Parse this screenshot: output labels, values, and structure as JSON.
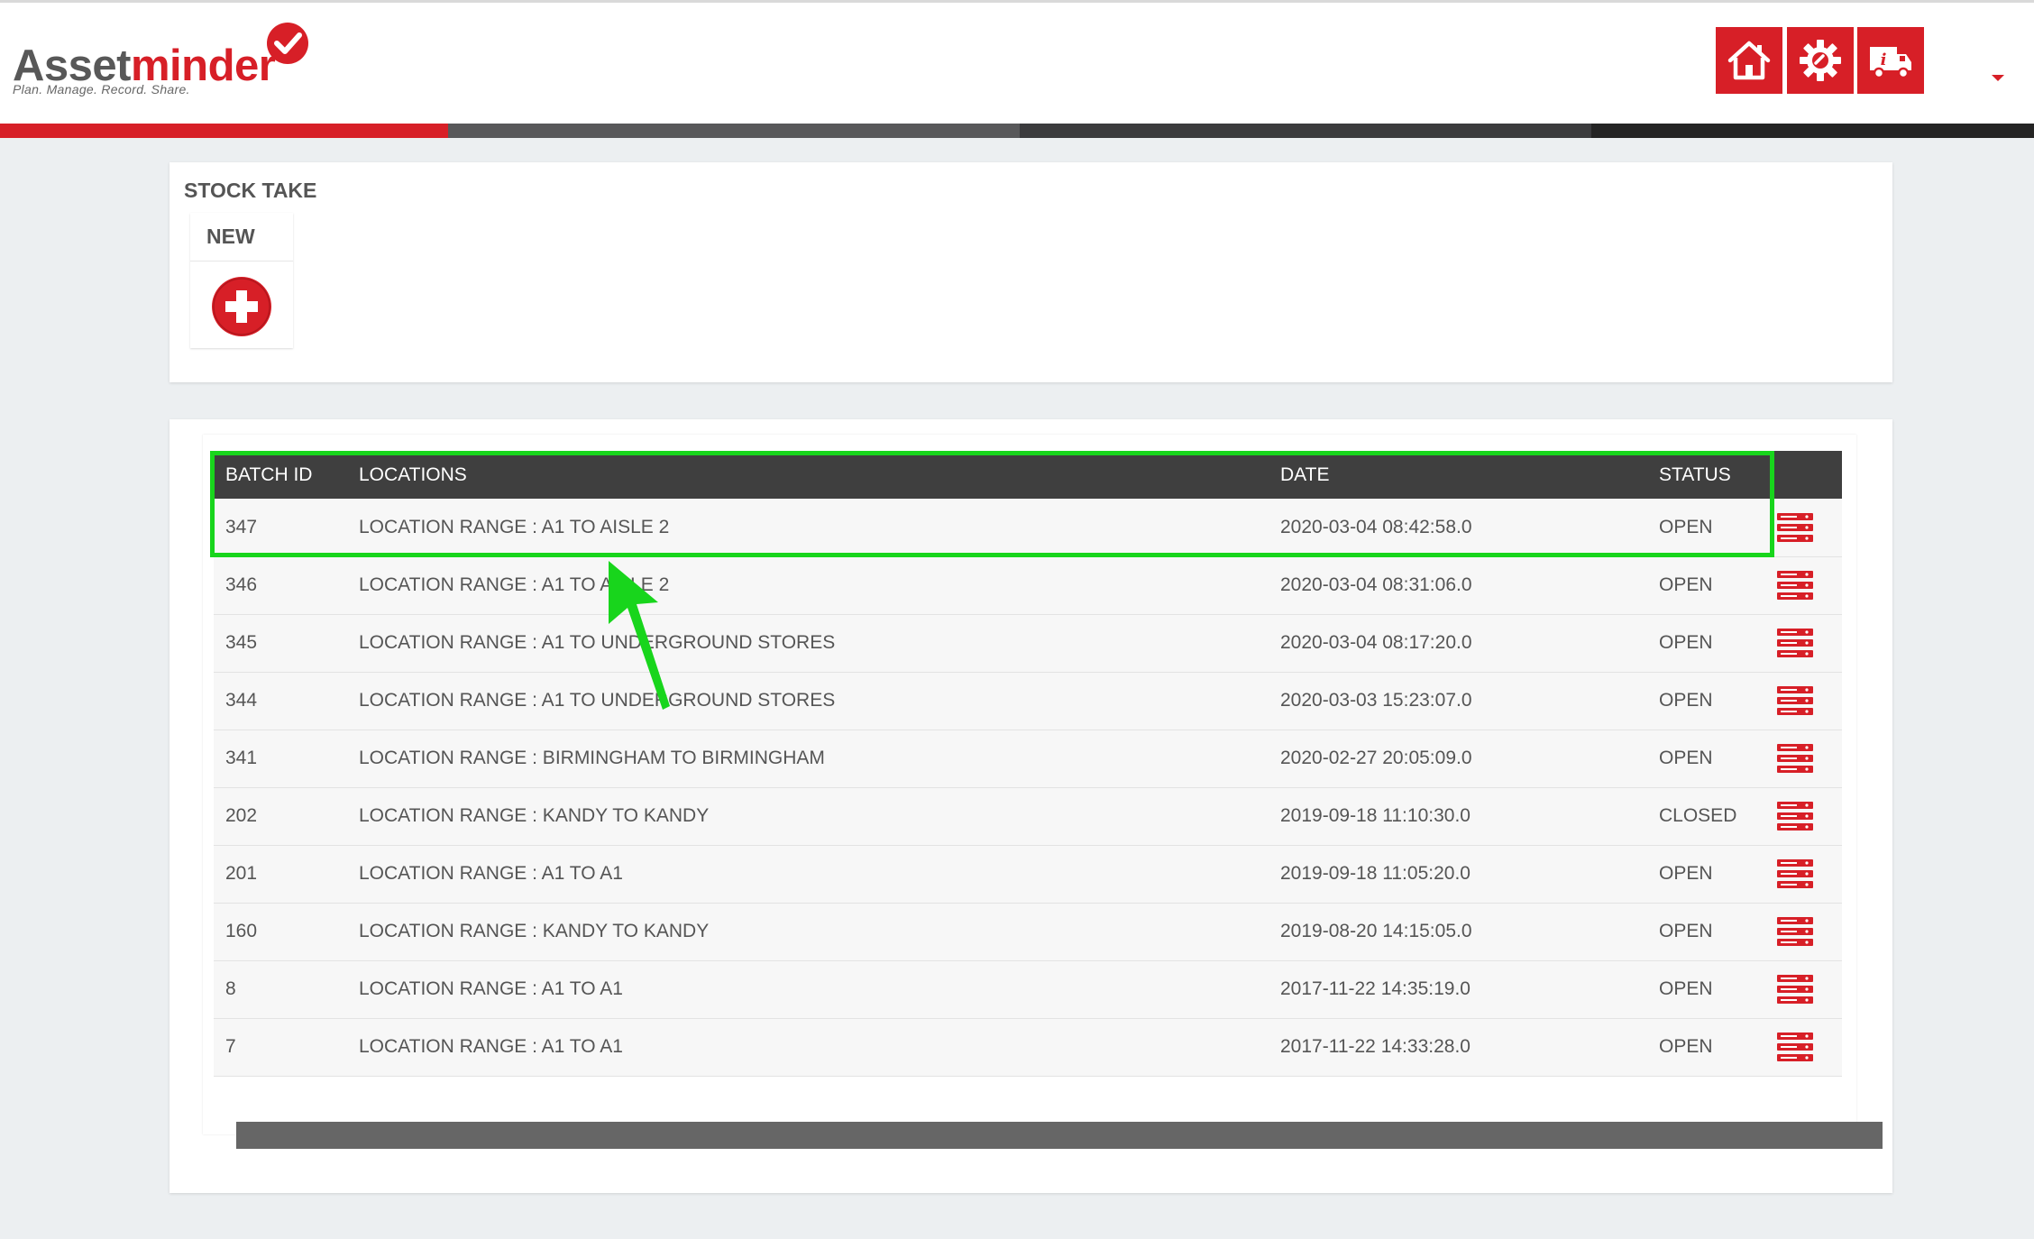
{
  "app": {
    "logo_text_a": "Asset",
    "logo_text_b": "minder",
    "logo_tagline": "Plan. Manage. Record. Share.",
    "brand_color": "#d71f27"
  },
  "header": {
    "buttons": [
      {
        "icon": "home-icon"
      },
      {
        "icon": "gear-icon"
      },
      {
        "icon": "truck-info-icon"
      }
    ],
    "colorbar": [
      "#d71f27",
      "#58585a",
      "#3b3b3d",
      "#242424"
    ]
  },
  "stock_take": {
    "title": "STOCK TAKE",
    "new_label": "NEW",
    "new_icon": "add-circle-icon"
  },
  "table": {
    "columns": [
      "BATCH ID",
      "LOCATIONS",
      "DATE",
      "STATUS"
    ],
    "rows": [
      {
        "batch_id": "347",
        "location": "LOCATION RANGE : A1 TO AISLE 2",
        "date": "2020-03-04 08:42:58.0",
        "status": "OPEN"
      },
      {
        "batch_id": "346",
        "location": "LOCATION RANGE : A1 TO AISLE 2",
        "date": "2020-03-04 08:31:06.0",
        "status": "OPEN"
      },
      {
        "batch_id": "345",
        "location": "LOCATION RANGE : A1 TO UNDERGROUND STORES",
        "date": "2020-03-04 08:17:20.0",
        "status": "OPEN"
      },
      {
        "batch_id": "344",
        "location": "LOCATION RANGE : A1 TO UNDERGROUND STORES",
        "date": "2020-03-03 15:23:07.0",
        "status": "OPEN"
      },
      {
        "batch_id": "341",
        "location": "LOCATION RANGE : BIRMINGHAM TO BIRMINGHAM",
        "date": "2020-02-27 20:05:09.0",
        "status": "OPEN"
      },
      {
        "batch_id": "202",
        "location": "LOCATION RANGE : KANDY TO KANDY",
        "date": "2019-09-18 11:10:30.0",
        "status": "CLOSED"
      },
      {
        "batch_id": "201",
        "location": "LOCATION RANGE : A1 TO A1",
        "date": "2019-09-18 11:05:20.0",
        "status": "OPEN"
      },
      {
        "batch_id": "160",
        "location": "LOCATION RANGE : KANDY TO KANDY",
        "date": "2019-08-20 14:15:05.0",
        "status": "OPEN"
      },
      {
        "batch_id": "8",
        "location": "LOCATION RANGE : A1 TO A1",
        "date": "2017-11-22 14:35:19.0",
        "status": "OPEN"
      },
      {
        "batch_id": "7",
        "location": "LOCATION RANGE : A1 TO A1",
        "date": "2017-11-22 14:33:28.0",
        "status": "OPEN"
      }
    ],
    "row_action_icon": "list-details-icon"
  },
  "annotation": {
    "highlight_color": "#18d51c"
  }
}
